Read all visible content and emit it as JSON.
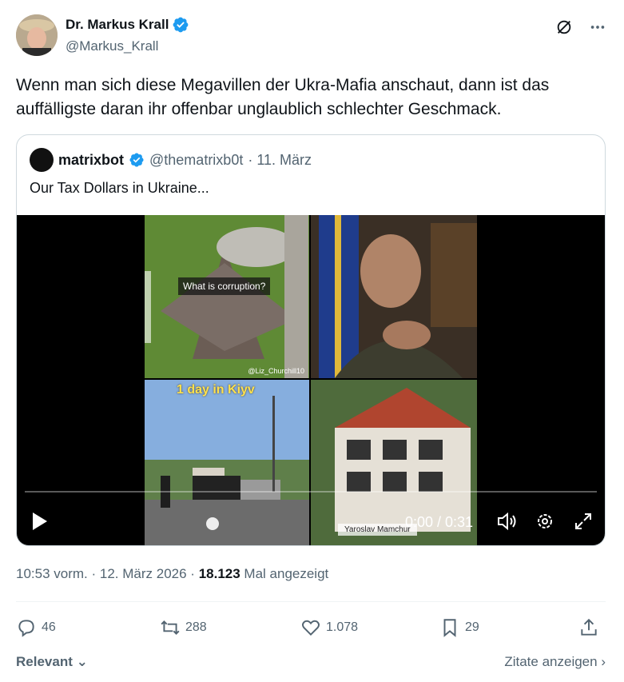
{
  "author": {
    "display_name": "Dr. Markus Krall",
    "handle": "@Markus_Krall"
  },
  "tweet": {
    "text": "Wenn man sich diese Megavillen der Ukra-Mafia anschaut, dann ist das auffälligste daran ihr offenbar unglaublich schlechter Geschmack."
  },
  "quoted": {
    "display_name": "matrixbot",
    "handle": "@thematrixb0t",
    "date": "· 11. März",
    "text": "Our Tax Dollars in Ukraine...",
    "video": {
      "overlay_question": "What is corruption?",
      "watermark": "@Liz_Churchill10",
      "day_label": "1 day in Kiyv",
      "caption": "Yaroslav Mamchur",
      "time": "0:00 / 0:31",
      "progress": 0
    }
  },
  "meta": {
    "time": "10:53 vorm.",
    "date": "· 12. März 2026 ·",
    "views": "18.123",
    "views_label": "Mal angezeigt"
  },
  "actions": {
    "replies": "46",
    "reposts": "288",
    "likes": "1.078",
    "bookmarks": "29"
  },
  "footer": {
    "sort_label": "Relevant",
    "quotes_label": "Zitate anzeigen"
  },
  "colors": {
    "verified": "#1d9bf0",
    "secondary_text": "#536471",
    "primary_text": "#0f1419"
  }
}
